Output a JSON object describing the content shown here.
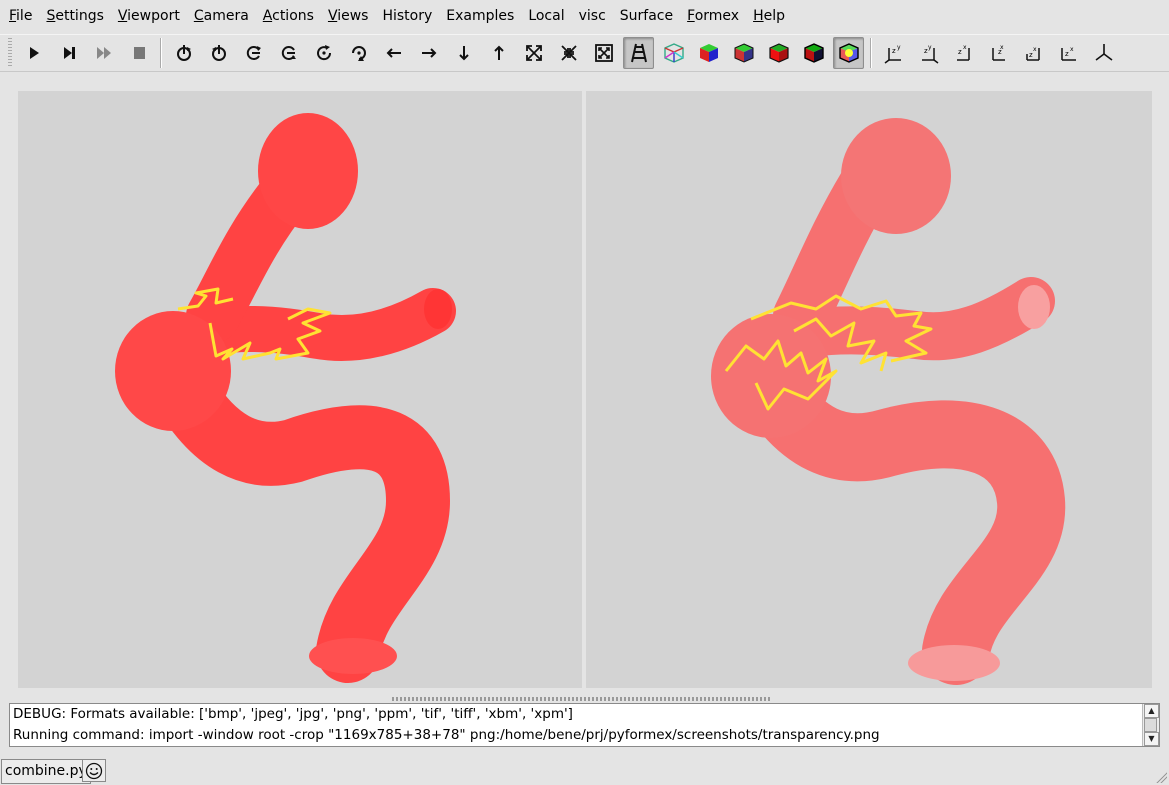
{
  "menu": [
    "File",
    "Settings",
    "Viewport",
    "Camera",
    "Actions",
    "Views",
    "History",
    "Examples",
    "Local",
    "visc",
    "Surface",
    "Formex",
    "Help"
  ],
  "toolbar": {
    "buttons": [
      "play-icon",
      "step-icon",
      "continue-icon",
      "stop-icon",
      "rotate-left-icon",
      "rotate-right-icon",
      "rotate-up-icon",
      "rotate-down-icon",
      "rotate-ccw-icon",
      "rotate-cw-icon",
      "pan-left-icon",
      "pan-right-icon",
      "pan-down-icon",
      "pan-up-icon",
      "zoom-in-icon",
      "zoom-out-icon",
      "zoom-all-icon",
      "perspective-icon",
      "wireframe-icon",
      "flat-shade-icon",
      "smooth-shade-icon",
      "red-cube-icon",
      "dark-cube-icon",
      "transparency-cube-icon",
      "front-view-icon",
      "back-view-icon",
      "top-view-icon",
      "bottom-view-icon",
      "left-view-icon",
      "right-view-icon",
      "iso-view-icon"
    ],
    "pressed": [
      "perspective-icon",
      "transparency-cube-icon"
    ]
  },
  "colors": {
    "surface": "#ff4a4a",
    "surface_transparent": "#f77070",
    "highlight": "#ffe233",
    "viewport_bg": "#d3d3d3",
    "window_bg": "#e4e4e4"
  },
  "console": {
    "lines": [
      "DEBUG: Formats available: ['bmp', 'jpeg', 'jpg', 'png', 'ppm', 'tif', 'tiff', 'xbm', 'xpm']",
      "Running command: import -window root -crop \"1169x785+38+78\" png:/home/bene/prj/pyformex/screenshots/transparency.png"
    ]
  },
  "status": {
    "file": "combine.py"
  }
}
